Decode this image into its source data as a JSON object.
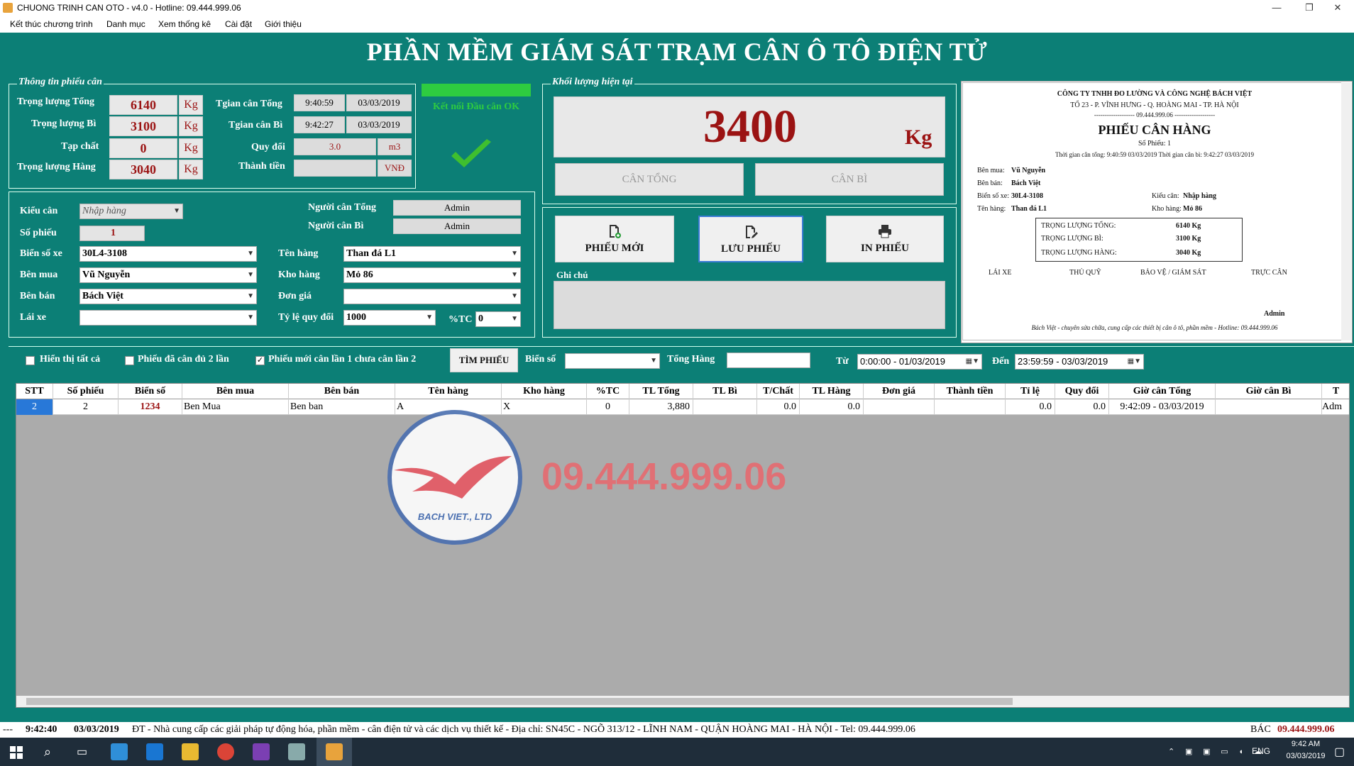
{
  "window": {
    "title": "CHUONG TRINH CAN OTO - v4.0 - Hotline: 09.444.999.06",
    "minimize": "—",
    "maximize": "❐",
    "close": "✕"
  },
  "menu": [
    "Kết thúc chương trình",
    "Danh mục",
    "Xem thống kê",
    "Cài đặt",
    "Giới thiệu"
  ],
  "header_title": "PHẦN MỀM GIÁM SÁT TRẠM CÂN Ô TÔ ĐIỆN TỬ",
  "ticket_info": {
    "legend": "Thông tin phiếu cân",
    "total_label": "Trọng lượng Tổng",
    "total_value": "6140",
    "unit": "Kg",
    "tare_label": "Trọng lượng Bì",
    "tare_value": "3100",
    "impurity_label": "Tạp chất",
    "impurity_value": "0",
    "net_label": "Trọng lượng Hàng",
    "net_value": "3040",
    "time_total_label": "Tgian cân Tổng",
    "time_total": "9:40:59",
    "date_total": "03/03/2019",
    "time_tare_label": "Tgian cân Bì",
    "time_tare": "9:42:27",
    "date_tare": "03/03/2019",
    "convert_label": "Quy đổi",
    "convert_value": "3.0",
    "convert_unit": "m3",
    "amount_label": "Thành tiền",
    "amount_value": "",
    "amount_unit": "VNĐ"
  },
  "connection": {
    "status": "Kết nối Đầu cân OK",
    "color": "#2ecc40"
  },
  "form": {
    "type_label": "Kiểu cân",
    "type_value": "Nhập hàng",
    "ticket_no_label": "Số phiếu",
    "ticket_no": "1",
    "plate_label": "Biển số xe",
    "plate": "30L4-3108",
    "buyer_label": "Bên mua",
    "buyer": "Vũ Nguyễn",
    "seller_label": "Bên bán",
    "seller": "Bách Việt",
    "driver_label": "Lái xe",
    "driver": "",
    "weigher_total_label": "Người cân Tổng",
    "weigher_total": "Admin",
    "weigher_tare_label": "Người cân Bì",
    "weigher_tare": "Admin",
    "goods_label": "Tên hàng",
    "goods": "Than đá L1",
    "warehouse_label": "Kho hàng",
    "warehouse": "Mỏ 86",
    "price_label": "Đơn giá",
    "price": "",
    "ratio_label": "Tỷ lệ quy đổi",
    "ratio": "1000",
    "tc_label": "%TC",
    "tc": "0"
  },
  "current": {
    "legend": "Khối lượng hiện tại",
    "value": "3400",
    "unit": "Kg",
    "btn_total": "CÂN TỔNG",
    "btn_tare": "CÂN BÌ"
  },
  "actions": {
    "new": "PHIẾU MỚI",
    "save": "LƯU PHIẾU",
    "print": "IN PHIẾU",
    "note_label": "Ghi chú"
  },
  "receipt": {
    "company": "CÔNG TY TNHH ĐO LƯỜNG VÀ CÔNG NGHỆ BÁCH VIỆT",
    "address": "TỔ 23 - P. VĨNH HƯNG - Q. HOÀNG MAI - TP. HÀ NỘI",
    "phone": "------------------- 09.444.999.06 -------------------",
    "title": "PHIẾU CÂN HÀNG",
    "no": "Số Phiếu: 1",
    "times": "Thời gian cân tổng: 9:40:59 03/03/2019      Thời gian cân bì: 9:42:27 03/03/2019",
    "buyer": "Bên mua:",
    "buyer_v": "Vũ Nguyễn",
    "seller": "Bên bán:",
    "seller_v": "Bách Việt",
    "plate": "Biển số xe:",
    "plate_v": "30L4-3108",
    "goods": "Tên hàng:",
    "goods_v": "Than đá L1",
    "type": "Kiểu cân:",
    "type_v": "Nhập hàng",
    "wh": "Kho hàng:",
    "wh_v": "Mỏ 86",
    "w_total": "TRỌNG LƯỢNG TỔNG:",
    "w_total_v": "6140 Kg",
    "w_tare": "TRỌNG LƯỢNG BÌ:",
    "w_tare_v": "3100 Kg",
    "w_net": "TRỌNG LƯỢNG HÀNG:",
    "w_net_v": "3040 Kg",
    "sig1": "LÁI XE",
    "sig2": "THỦ QUỸ",
    "sig3": "BẢO VỆ / GIÁM SÁT",
    "sig4": "TRỰC CÂN",
    "signer": "Admin",
    "footer": "Bách Việt - chuyên sửa chữa, cung cấp các thiết bị cân ô tô, phần mềm - Hotline: 09.444.999.06"
  },
  "filter": {
    "show_all": "Hiển thị tất cả",
    "show_done": "Phiếu đã cân đủ 2 lần",
    "show_new": "Phiếu mới cân lần 1 chưa cân lần 2",
    "find_btn": "TÌM PHIẾU",
    "plate_label": "Biển số",
    "goods_label": "Tổng Hàng",
    "from_label": "Từ",
    "from_value": "0:00:00 - 01/03/2019",
    "to_label": "Đến",
    "to_value": "23:59:59 - 03/03/2019"
  },
  "table": {
    "columns": [
      "STT",
      "Số phiếu",
      "Biển số",
      "Bên mua",
      "Bên bán",
      "Tên hàng",
      "Kho hàng",
      "%TC",
      "TL Tổng",
      "TL Bì",
      "T/Chất",
      "TL Hàng",
      "Đơn giá",
      "Thành tiền",
      "Tỉ lệ",
      "Quy đổi",
      "Giờ cân Tổng",
      "Giờ cân Bì",
      "T"
    ],
    "rows": [
      [
        "2",
        "2",
        "1234",
        "Ben Mua",
        "Ben ban",
        "A",
        "X",
        "0",
        "3,880",
        "",
        "0.0",
        "0.0",
        "",
        "",
        "0.0",
        "0.0",
        "9:42:09 - 03/03/2019",
        "",
        "Adm"
      ]
    ]
  },
  "watermark": {
    "phone": "09.444.999.06",
    "logo_text": "BACH VIET., LTD"
  },
  "status": {
    "time": "9:42:40",
    "date": "03/03/2019",
    "marquee": "ĐT - Nhà cung cấp các giải pháp tự động hóa, phần mềm - cân điện tử và các dịch vụ thiết kế - Địa chỉ: SN45C - NGÕ 313/12 - LĨNH NAM - QUẬN HOÀNG MAI - HÀ NỘI - Tel: 09.444.999.06",
    "tail": "BÁC",
    "hotline": "09.444.999.06"
  },
  "taskbar": {
    "lang": "ENG",
    "time": "9:42 AM",
    "date": "03/03/2019"
  }
}
